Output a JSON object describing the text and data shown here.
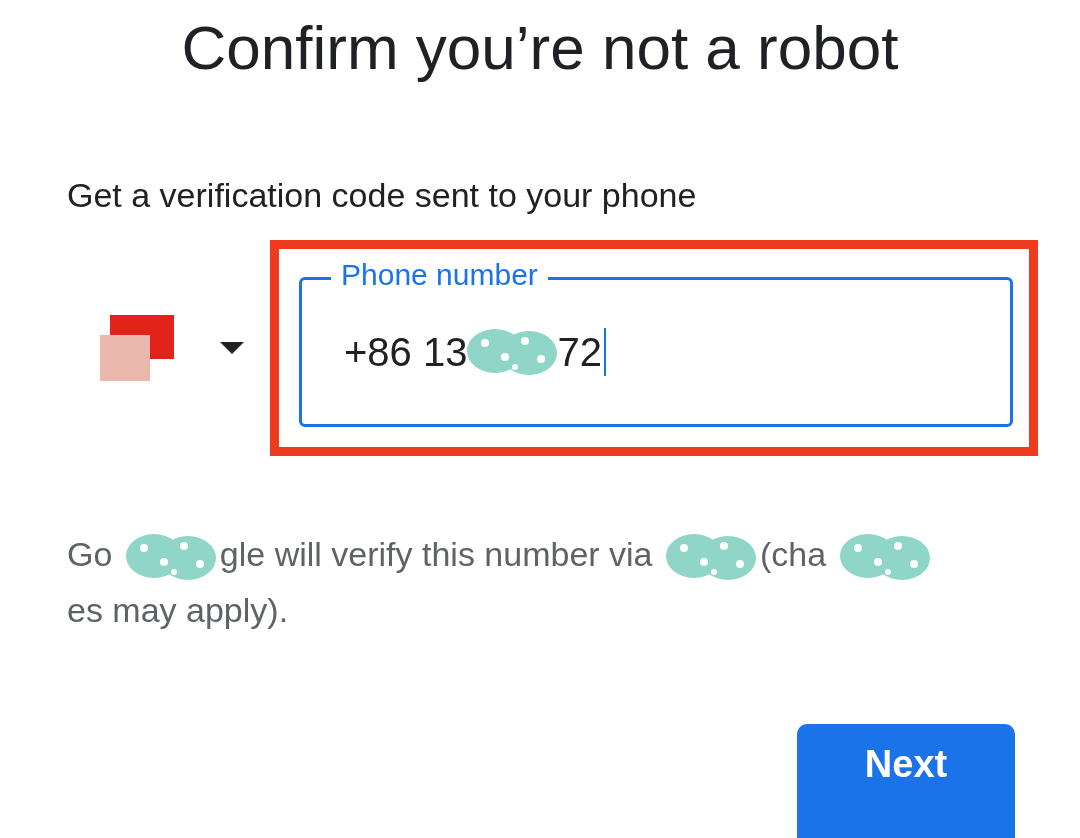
{
  "title": "Confirm you’re not a robot",
  "subtitle": "Get a verification code sent to your phone",
  "phone_field": {
    "label": "Phone number",
    "focused": true,
    "highlighted": true,
    "segments": [
      {
        "kind": "text",
        "text": "+86 13"
      },
      {
        "kind": "redaction"
      },
      {
        "kind": "text",
        "text": "72"
      }
    ]
  },
  "notice": {
    "segments": [
      {
        "kind": "text",
        "text": "Go"
      },
      {
        "kind": "redaction"
      },
      {
        "kind": "text",
        "text": "gle will verify this number via"
      },
      {
        "kind": "redaction"
      },
      {
        "kind": "text",
        "text": "(cha"
      },
      {
        "kind": "redaction"
      },
      {
        "kind": "text",
        "text": "es may"
      },
      {
        "kind": "text",
        "text": "apply)."
      }
    ]
  },
  "next_button": {
    "label": "Next"
  }
}
